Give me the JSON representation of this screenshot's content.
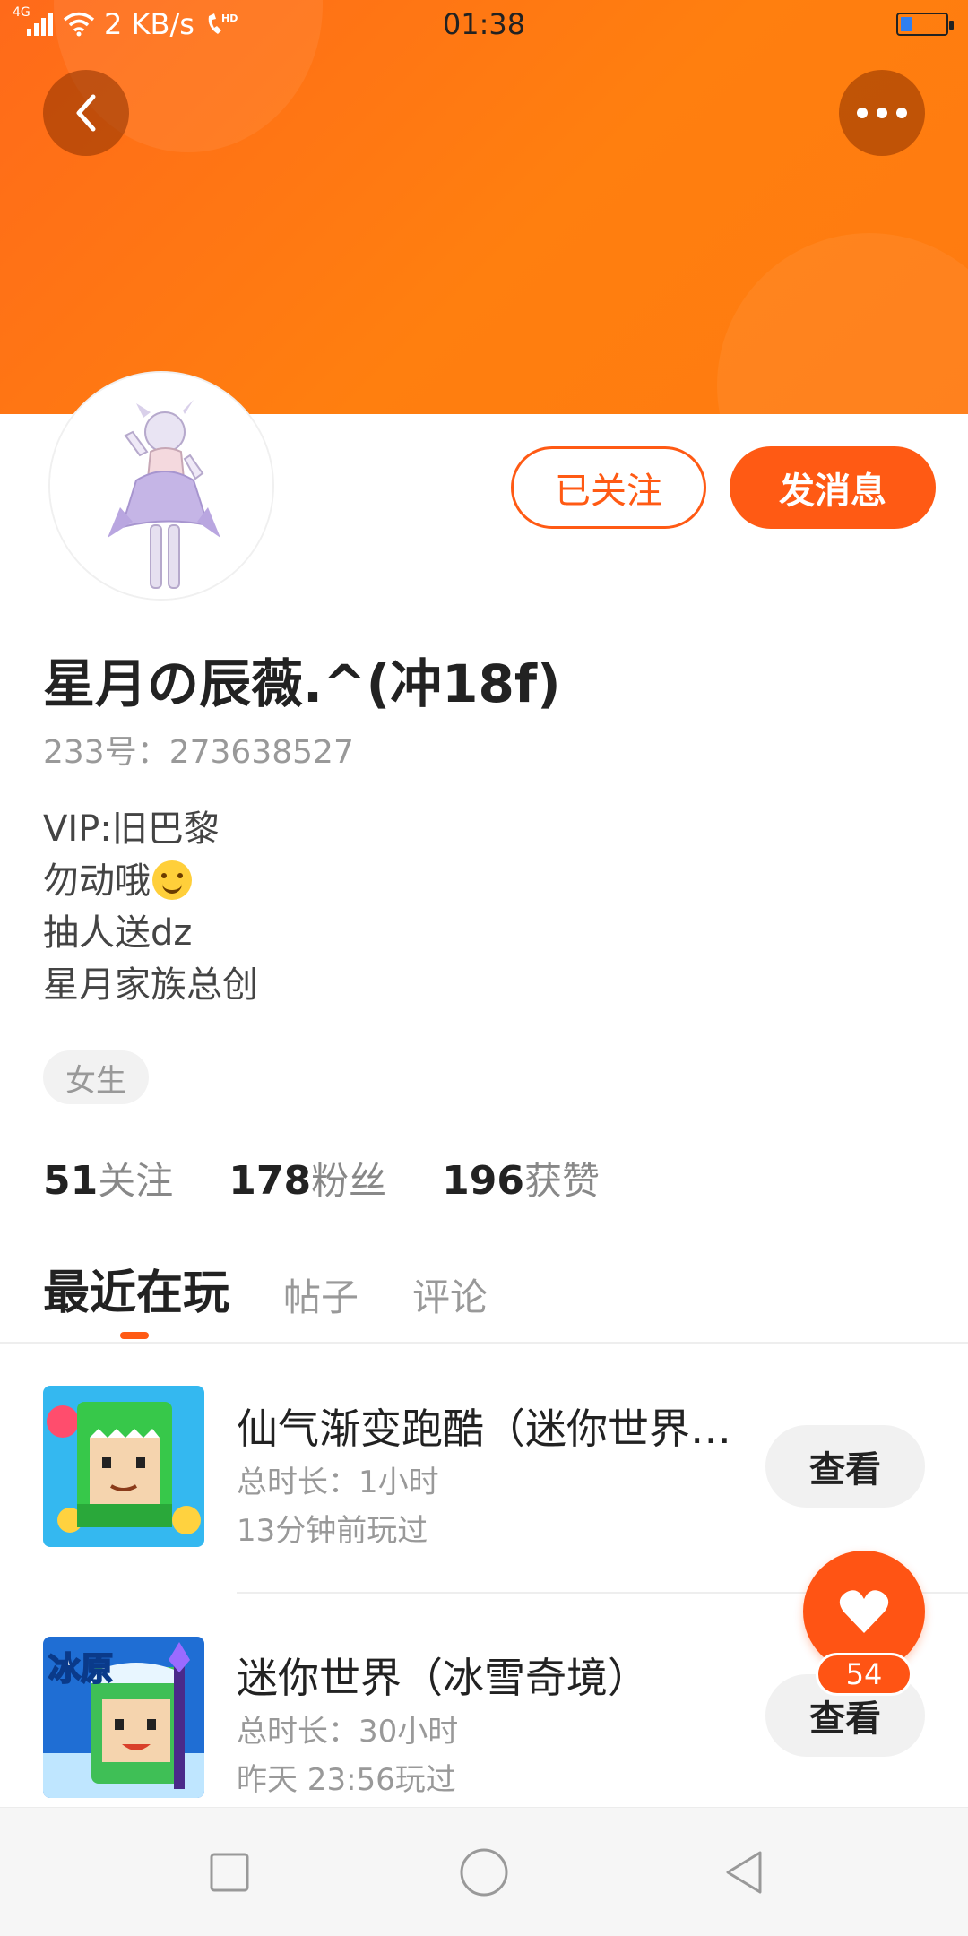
{
  "status_bar": {
    "network": "4G",
    "speed": "2 KB/s",
    "hd": "HD",
    "time": "01:38"
  },
  "header": {
    "back_icon": "chevron-left-icon",
    "more_icon": "more-dots-icon"
  },
  "profile": {
    "nickname": "星月の辰薇.^(冲18f)",
    "id_text": "233号：273638527",
    "bio_lines": [
      "VIP:旧巴黎",
      "勿动哦",
      "抽人送dz",
      "星月家族总创"
    ],
    "gender_tag": "女生",
    "follow_button": "已关注",
    "message_button": "发消息"
  },
  "stats": [
    {
      "value": "51",
      "label": "关注"
    },
    {
      "value": "178",
      "label": "粉丝"
    },
    {
      "value": "196",
      "label": "获赞"
    }
  ],
  "tabs": [
    "最近在玩",
    "帖子",
    "评论"
  ],
  "games": [
    {
      "title": "仙气渐变跑酷（迷你世界…",
      "duration": "总时长：1小时",
      "last_played": "13分钟前玩过",
      "action": "查看"
    },
    {
      "title": "迷你世界（冰雪奇境）",
      "duration": "总时长：30小时",
      "last_played": "昨天 23:56玩过",
      "action": "查看",
      "icon_label": "冰原"
    }
  ],
  "like_fab": {
    "count": "54"
  },
  "colors": {
    "accent": "#ff5a14",
    "header": "#ff7a10"
  }
}
